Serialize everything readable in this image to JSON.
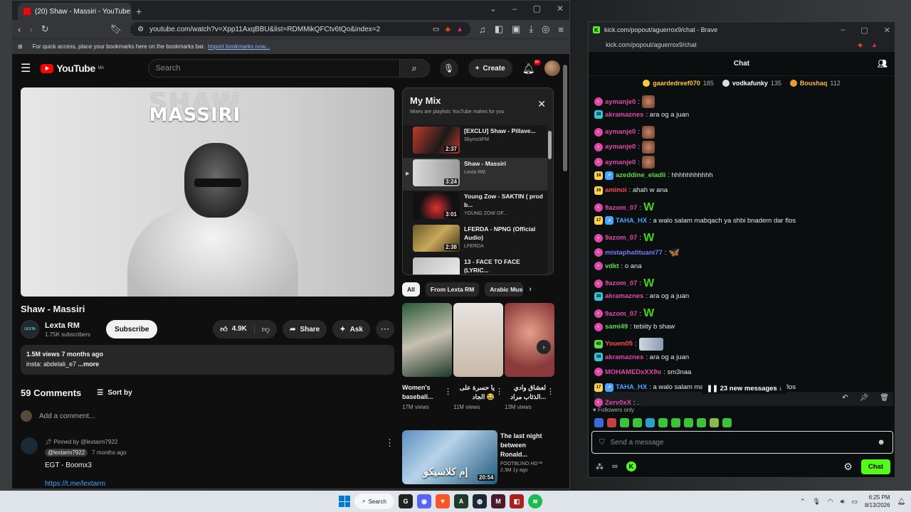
{
  "youtube_window": {
    "tab_title": "(20) Shaw - Massiri - YouTube",
    "url": "youtube.com/watch?v=Xpp11AxqBBU&list=RDMMikQFCtv6tQo&index=2",
    "bookmarks_hint": "For quick access, place your bookmarks here on the bookmarks bar.",
    "import_link": "Import bookmarks now...",
    "logo": "YouTube",
    "logo_region": "MA",
    "search_placeholder": "Search",
    "create_label": "Create",
    "notif_count": "9+",
    "thumbnail_title_line1": "SHAW",
    "thumbnail_title_line2": "MASSIRI",
    "video_title": "Shaw - Massiri",
    "channel_name": "Lexta RM",
    "channel_avatar_text": "LEXTA",
    "subscribers": "1.75K subscribers",
    "subscribe_label": "Subscribe",
    "likes": "4.9K",
    "share_label": "Share",
    "ask_label": "Ask",
    "views_date": "1.5M views  7 months ago",
    "desc_text": "insta: abdelali_e7 ",
    "desc_more": "...more",
    "comments_count": "59 Comments",
    "sort_label": "Sort by",
    "add_comment": "Add a comment...",
    "pinned_by": "Pinned by @lextarm7922",
    "comment_author": "@lextarm7922",
    "comment_time": "7 months ago",
    "comment_text": "EGT - Boomx3",
    "comment_link": "https://t.me/lextarm",
    "mix": {
      "title": "My Mix",
      "subtitle": "Mixes are playlists YouTube makes for you",
      "items": [
        {
          "title": "[EXCLU] Shaw - Pillave...",
          "author": "SkyrockFM",
          "duration": "2:37"
        },
        {
          "title": "Shaw - Massiri",
          "author": "Lexta RM",
          "duration": "3:24"
        },
        {
          "title": "Young Zow - SAKTIN ( prod b...",
          "author": "YOUNG ZOW OF...",
          "duration": "3:01"
        },
        {
          "title": "LFERDA - NPNG (Official Audio)",
          "author": "LFERDA",
          "duration": "2:38"
        },
        {
          "title": "13 - FACE TO FACE (LYRIC...",
          "author": "",
          "duration": ""
        }
      ]
    },
    "chips": [
      "All",
      "From Lexta RM",
      "Arabic Music"
    ],
    "shorts": [
      {
        "title": "Women's baseball...",
        "views": "17M views"
      },
      {
        "title": "يا حسرة على الجاد 😂",
        "views": "11M views"
      },
      {
        "title": "لعشاق وادي الذئاب مراد...",
        "views": "13M views"
      }
    ],
    "rec": {
      "title": "The last night between Ronald...",
      "channel": "FOOTBLINO HD™",
      "views": "2.3M  1y ago",
      "duration": "20:54",
      "overlay": "إم كلاسيكو"
    }
  },
  "kick_window": {
    "title": "kick.com/popout/aguerrox9/chat - Brave",
    "url": "kick.com/popout/aguerrox9/chat",
    "chat_title": "Chat",
    "gifters": [
      {
        "name": "gaardedreef070",
        "count": "185"
      },
      {
        "name": "vodkafunky",
        "count": "135"
      },
      {
        "name": "Boushaq",
        "count": "112"
      }
    ],
    "messages": [
      {
        "badge": "",
        "name": "aymanje0",
        "color": "#e048a8",
        "text": ":",
        "emote": "img",
        "cut": true
      },
      {
        "badge": "38",
        "name": "akramaznes",
        "color": "#e048a8",
        "text": ": ara og a juan",
        "emote": ""
      },
      {
        "badge": "",
        "name": "aymanje0",
        "color": "#e048a8",
        "text": ":",
        "emote": "img"
      },
      {
        "badge": "",
        "name": "aymanje0",
        "color": "#e048a8",
        "text": ":",
        "emote": "img"
      },
      {
        "badge": "",
        "name": "aymanje0",
        "color": "#e048a8",
        "text": ":",
        "emote": "img"
      },
      {
        "badge": "18",
        "name": "azeddine_eladli",
        "color": "#5fd84b",
        "text": ": hhhhhhhhhhh",
        "emote": ""
      },
      {
        "badge": "16",
        "name": "aminoi",
        "color": "#ff4a4a",
        "text": ": ahah w ana",
        "emote": ""
      },
      {
        "badge": "",
        "name": "9azom_07",
        "color": "#e048a8",
        "text": ":",
        "emote": "W"
      },
      {
        "badge": "17",
        "name": "TAHA_HX",
        "color": "#4aa3ff",
        "text": ": a walo salam mabqach ya shbi bnadem dar flos",
        "emote": ""
      },
      {
        "badge": "",
        "name": "9azom_07",
        "color": "#e048a8",
        "text": ":",
        "emote": "W"
      },
      {
        "badge": "",
        "name": "mistaphatituani77",
        "color": "#7a7aff",
        "text": ":",
        "emote": "🦋"
      },
      {
        "badge": "",
        "name": "vdkt",
        "color": "#5fd84b",
        "text": ": o ana",
        "emote": ""
      },
      {
        "badge": "",
        "name": "9azom_07",
        "color": "#e048a8",
        "text": ":",
        "emote": "W"
      },
      {
        "badge": "38",
        "name": "akramaznes",
        "color": "#e048a8",
        "text": ": ara og a juan",
        "emote": ""
      },
      {
        "badge": "",
        "name": "9azom_07",
        "color": "#e048a8",
        "text": ":",
        "emote": "W"
      },
      {
        "badge": "",
        "name": "sami49",
        "color": "#5fd84b",
        "text": ": tebiity b shaw",
        "emote": ""
      },
      {
        "badge": "40",
        "name": "Youen05",
        "color": "#ff4a4a",
        "text": ":",
        "emote": "img"
      },
      {
        "badge": "38",
        "name": "akramaznes",
        "color": "#e048a8",
        "text": ": ara og a juan",
        "emote": ""
      },
      {
        "badge": "",
        "name": "MOHAMEDxXX9o",
        "color": "#e048a8",
        "text": ": sm3naa",
        "emote": ""
      },
      {
        "badge": "17",
        "name": "TAHA_HX",
        "color": "#4aa3ff",
        "text": ": a walo salam mabqach ya shbi bnadem dar flos",
        "emote": ""
      },
      {
        "badge": "",
        "name": "Zerv0xX",
        "color": "#e048a8",
        "text": ": .",
        "emote": ""
      }
    ],
    "new_messages": "23 new messages",
    "followers_only": "Followers only",
    "input_placeholder": "Send a message",
    "chat_button": "Chat"
  },
  "taskbar": {
    "search_label": "Search",
    "time": "6:25 PM",
    "date": "8/13/2026"
  }
}
